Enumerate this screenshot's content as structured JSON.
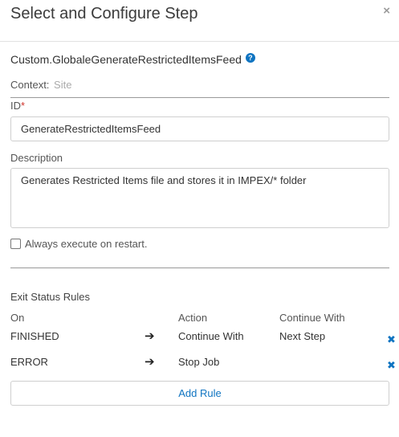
{
  "dialog": {
    "title": "Select and Configure Step",
    "close_glyph": "×"
  },
  "step": {
    "name": "Custom.GlobaleGenerateRestrictedItemsFeed",
    "help_glyph": "?"
  },
  "context": {
    "label": "Context:",
    "value": "Site"
  },
  "id_field": {
    "label": "ID",
    "required_mark": "*",
    "value": "GenerateRestrictedItemsFeed"
  },
  "description": {
    "label": "Description",
    "value": "Generates Restricted Items file and stores it in IMPEX/* folder"
  },
  "restart": {
    "label": "Always execute on restart.",
    "checked": false
  },
  "exit_rules": {
    "title": "Exit Status Rules",
    "headers": {
      "on": "On",
      "action": "Action",
      "continue_with": "Continue With"
    },
    "rows": [
      {
        "on": "FINISHED",
        "action": "Continue With",
        "continue_with": "Next Step"
      },
      {
        "on": "ERROR",
        "action": "Stop Job",
        "continue_with": ""
      }
    ],
    "arrow_glyph": "➔",
    "remove_glyph": "✖",
    "add_label": "Add Rule"
  },
  "colors": {
    "accent": "#0f74c1",
    "required": "#d0342c"
  }
}
